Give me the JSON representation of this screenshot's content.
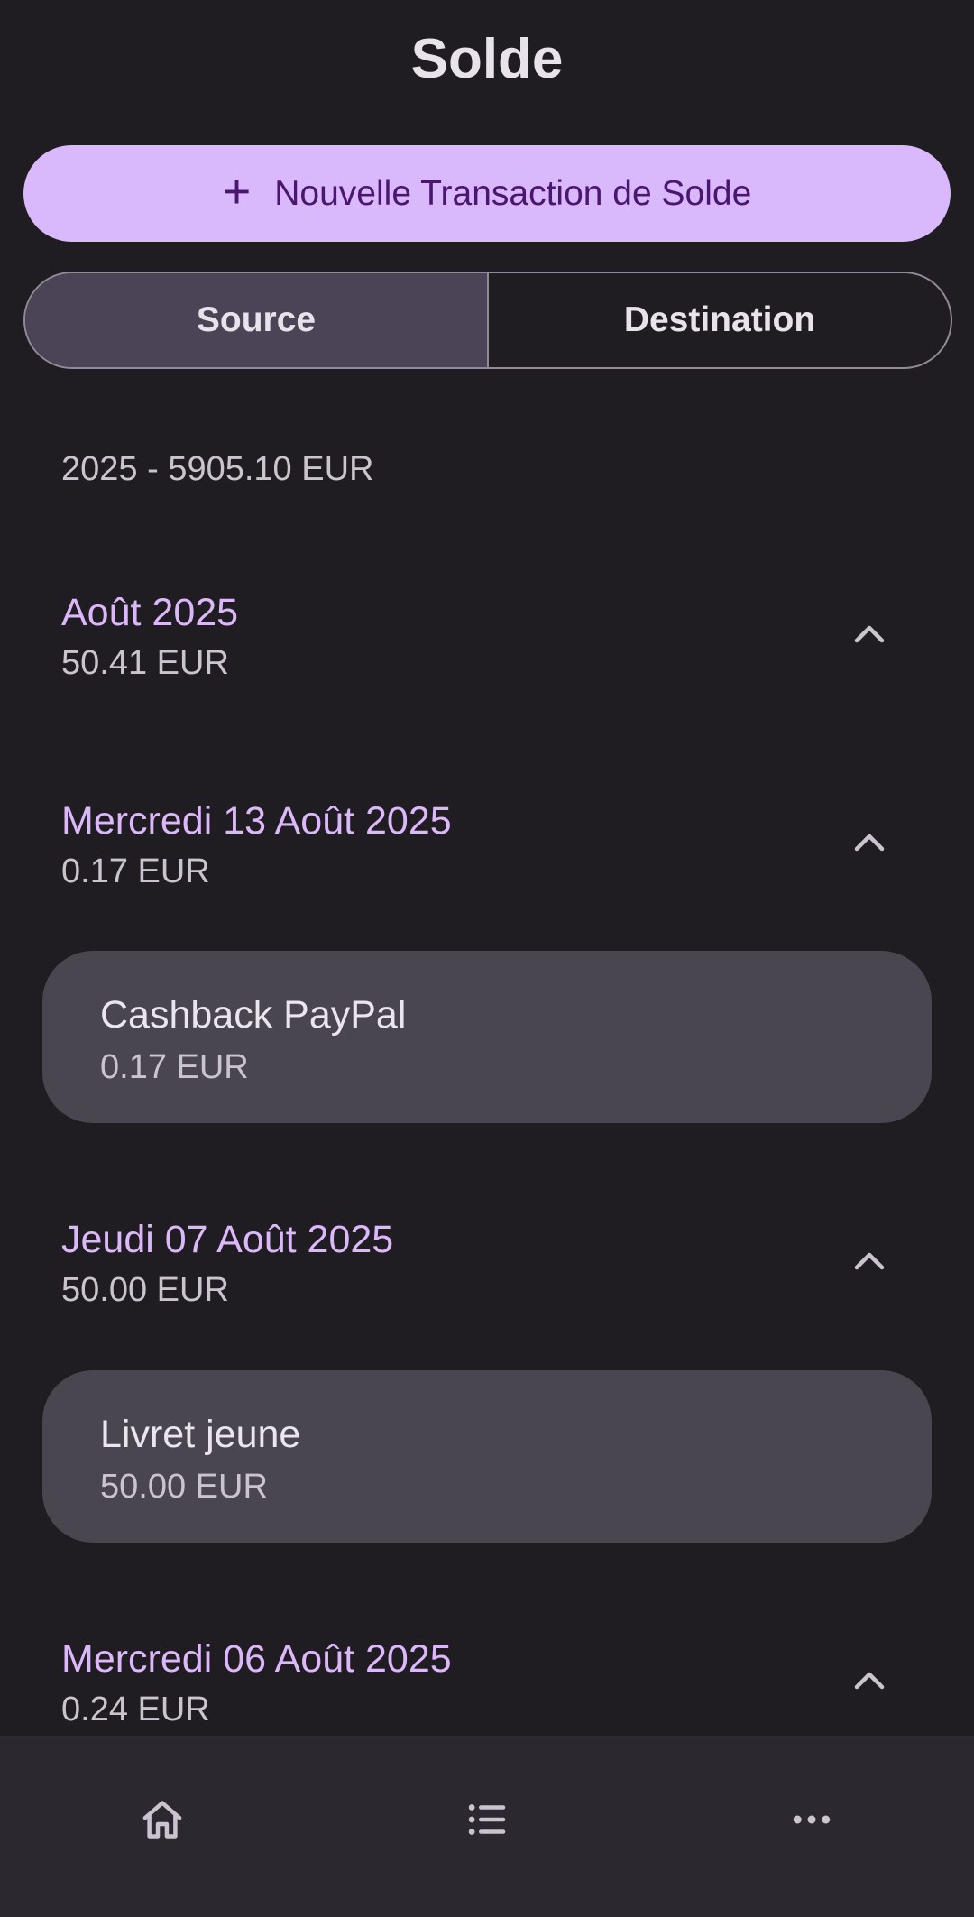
{
  "header": {
    "title": "Solde"
  },
  "actions": {
    "new_transaction_label": "Nouvelle Transaction de Solde",
    "plus_icon": "plus-icon"
  },
  "tabs": [
    {
      "label": "Source",
      "selected": true
    },
    {
      "label": "Destination",
      "selected": false
    }
  ],
  "summary": {
    "year_total": "2025 - 5905.10 EUR"
  },
  "groups": [
    {
      "title": "Août 2025",
      "amount": "50.41 EUR",
      "icon": "chevron-up-icon"
    },
    {
      "title": "Mercredi 13 Août 2025",
      "amount": "0.17 EUR",
      "icon": "chevron-up-icon"
    },
    {
      "title": "Jeudi 07 Août 2025",
      "amount": "50.00 EUR",
      "icon": "chevron-up-icon"
    },
    {
      "title": "Mercredi 06 Août 2025",
      "amount": "0.24 EUR",
      "icon": "chevron-up-icon"
    }
  ],
  "transactions": [
    {
      "label": "Cashback PayPal",
      "amount": "0.17 EUR"
    },
    {
      "label": "Livret jeune",
      "amount": "50.00 EUR"
    }
  ],
  "bottom_nav": [
    {
      "icon": "home-icon"
    },
    {
      "icon": "list-icon"
    },
    {
      "icon": "more-icon"
    }
  ],
  "colors": {
    "background": "#1f1c22",
    "accent": "#d9b8fb",
    "accent_text": "#4a1670",
    "group_title": "#dcb8fb",
    "card": "#4a4650",
    "segment_active": "#4b4356",
    "nav_bar": "#2b2830"
  }
}
